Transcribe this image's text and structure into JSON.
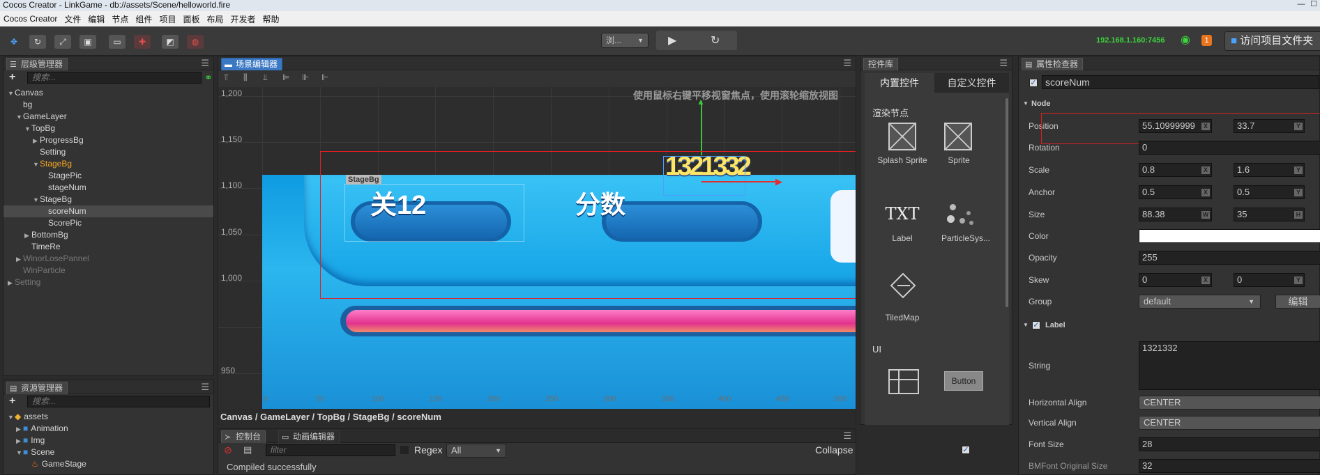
{
  "titlebar": {
    "title": "Cocos Creator - LinkGame - db://assets/Scene/helloworld.fire"
  },
  "menubar": {
    "items": [
      "Cocos Creator",
      "文件",
      "编辑",
      "节点",
      "组件",
      "项目",
      "面板",
      "布局",
      "开发者",
      "帮助"
    ]
  },
  "toolbar": {
    "platform": "浏...",
    "ip": "192.168.1.160:7456",
    "notification_count": "1",
    "visit_project": "访问项目文件夹"
  },
  "hierarchy": {
    "tab": "层级管理器",
    "search_placeholder": "搜索...",
    "nodes": [
      {
        "label": "Canvas",
        "indent": 0,
        "arrow": "▼",
        "style": ""
      },
      {
        "label": "bg",
        "indent": 1,
        "arrow": "",
        "style": ""
      },
      {
        "label": "GameLayer",
        "indent": 1,
        "arrow": "▼",
        "style": ""
      },
      {
        "label": "TopBg",
        "indent": 2,
        "arrow": "▼",
        "style": ""
      },
      {
        "label": "ProgressBg",
        "indent": 3,
        "arrow": "▶",
        "style": ""
      },
      {
        "label": "Setting",
        "indent": 3,
        "arrow": "",
        "style": ""
      },
      {
        "label": "StageBg",
        "indent": 3,
        "arrow": "▼",
        "style": "orange"
      },
      {
        "label": "StagePic",
        "indent": 4,
        "arrow": "",
        "style": ""
      },
      {
        "label": "stageNum",
        "indent": 4,
        "arrow": "",
        "style": ""
      },
      {
        "label": "StageBg",
        "indent": 3,
        "arrow": "▼",
        "style": ""
      },
      {
        "label": "scoreNum",
        "indent": 4,
        "arrow": "",
        "style": "sel"
      },
      {
        "label": "ScorePic",
        "indent": 4,
        "arrow": "",
        "style": ""
      },
      {
        "label": "BottomBg",
        "indent": 2,
        "arrow": "▶",
        "style": ""
      },
      {
        "label": "TimeRe",
        "indent": 2,
        "arrow": "",
        "style": ""
      },
      {
        "label": "WinorLosePannel",
        "indent": 1,
        "arrow": "▶",
        "style": "dim"
      },
      {
        "label": "WinParticle",
        "indent": 1,
        "arrow": "",
        "style": "dim"
      },
      {
        "label": "Setting",
        "indent": 0,
        "arrow": "▶",
        "style": "dim"
      }
    ]
  },
  "assets": {
    "tab": "资源管理器",
    "search_placeholder": "搜索...",
    "items": [
      {
        "label": "assets",
        "indent": 0,
        "arrow": "▼",
        "icon": "db"
      },
      {
        "label": "Animation",
        "indent": 1,
        "arrow": "▶",
        "icon": "folder"
      },
      {
        "label": "Img",
        "indent": 1,
        "arrow": "▶",
        "icon": "folder"
      },
      {
        "label": "Scene",
        "indent": 1,
        "arrow": "▼",
        "icon": "folder"
      },
      {
        "label": "GameStage",
        "indent": 2,
        "arrow": "",
        "icon": "fire"
      }
    ]
  },
  "scene": {
    "tab": "场景编辑器",
    "hint": "使用鼠标右键平移视窗焦点，使用滚轮缩放视图",
    "y_labels": [
      "1,200",
      "1,150",
      "1,100",
      "1,050",
      "1,000",
      "950"
    ],
    "x_labels": [
      "0",
      "50",
      "100",
      "150",
      "200",
      "250",
      "300",
      "350",
      "400",
      "450",
      "500"
    ],
    "stage_label_tag": "StageBg",
    "stage_text": "关12",
    "score_label": "分数",
    "score_num": "1321332",
    "breadcrumb": "Canvas / GameLayer / TopBg / StageBg / scoreNum"
  },
  "widgets": {
    "tab": "控件库",
    "subtabs": [
      "内置控件",
      "自定义控件"
    ],
    "section_render": "渲染节点",
    "items": [
      "Splash Sprite",
      "Sprite",
      "Label",
      "ParticleSys...",
      "TiledMap"
    ],
    "label_icon_text": "TXT",
    "section_ui": "UI",
    "button_label": "Button"
  },
  "console": {
    "tabs": [
      "控制台",
      "动画编辑器"
    ],
    "filter_placeholder": "filter",
    "regex_label": "Regex",
    "level": "All",
    "collapse_label": "Collapse",
    "message": "Compiled successfully"
  },
  "inspector": {
    "tab": "属性检查器",
    "node_name": "scoreNum",
    "node_section": "Node",
    "position": {
      "label": "Position",
      "x": "55.10999999",
      "y": "33.7"
    },
    "rotation": {
      "label": "Rotation",
      "value": "0"
    },
    "scale": {
      "label": "Scale",
      "x": "0.8",
      "y": "1.6"
    },
    "anchor": {
      "label": "Anchor",
      "x": "0.5",
      "y": "0.5"
    },
    "size": {
      "label": "Size",
      "w": "88.38",
      "h": "35"
    },
    "color": {
      "label": "Color"
    },
    "opacity": {
      "label": "Opacity",
      "value": "255"
    },
    "skew": {
      "label": "Skew",
      "x": "0",
      "y": "0"
    },
    "group": {
      "label": "Group",
      "value": "default",
      "edit": "编辑"
    },
    "label_section": "Label",
    "string": {
      "label": "String",
      "value": "1321332"
    },
    "halign": {
      "label": "Horizontal Align",
      "value": "CENTER"
    },
    "valign": {
      "label": "Vertical Align",
      "value": "CENTER"
    },
    "font_size": {
      "label": "Font Size",
      "value": "28"
    },
    "bmfont": {
      "label": "BMFont Original Size",
      "value": "32"
    }
  },
  "colors": {
    "accent": "#3b78c4",
    "ip_green": "#3cd23c",
    "selection_orange": "#f5a623",
    "highlight_red": "#e02020"
  }
}
